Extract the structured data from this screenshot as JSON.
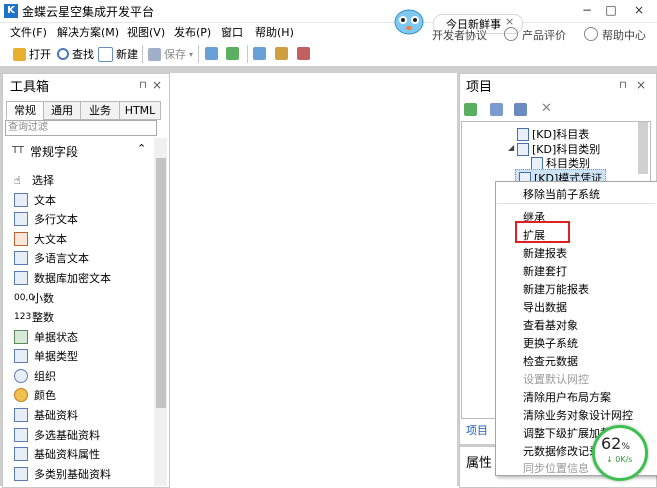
{
  "app": {
    "title": "金蝶云星空集成开发平台",
    "icon_glyph": "K"
  },
  "window_controls": [
    "−",
    "□",
    "×"
  ],
  "menu": [
    "文件(F)",
    "解决方案(M)",
    "视图(V)",
    "发布(P)",
    "窗口",
    "帮助(H)"
  ],
  "toolbar": {
    "open": "打开",
    "find": "查找",
    "new": "新建",
    "save": "保存"
  },
  "notification": {
    "text": "今日新鲜事",
    "close": "×"
  },
  "top_links": {
    "partial": "开发者协议",
    "rating": "产品评价",
    "help": "帮助中心"
  },
  "toolbox": {
    "title": "工具箱",
    "pin": "⊓",
    "close": "×",
    "tabs": [
      "常规",
      "通用",
      "业务",
      "HTML"
    ],
    "filter_placeholder": "查询过滤",
    "section_icon": "TT",
    "section": "常规字段",
    "items": [
      "选择",
      "文本",
      "多行文本",
      "大文本",
      "多语言文本",
      "数据库加密文本",
      "小数",
      "整数",
      "单据状态",
      "单据类型",
      "组织",
      "颜色",
      "基础资料",
      "多选基础资料",
      "基础资料属性",
      "多类别基础资料"
    ]
  },
  "project": {
    "title": "项目",
    "pin": "⊓",
    "close": "×",
    "tree": [
      {
        "label": "[KD]科目表",
        "level": 0
      },
      {
        "label": "[KD]科目类别",
        "level": 0,
        "expanded": true
      },
      {
        "label": "科目类别",
        "level": 1
      },
      {
        "label": "[KD]模式凭证",
        "level": 0
      }
    ],
    "tab_label": "项目"
  },
  "properties": {
    "title": "属性"
  },
  "context_menu": {
    "items": [
      {
        "label": "移除当前子系统",
        "enabled": true
      },
      {
        "label": "继承",
        "enabled": true
      },
      {
        "label": "扩展",
        "enabled": true,
        "highlighted": true
      },
      {
        "label": "新建报表",
        "enabled": true
      },
      {
        "label": "新建套打",
        "enabled": true
      },
      {
        "label": "新建万能报表",
        "enabled": true
      },
      {
        "label": "导出数据",
        "enabled": true
      },
      {
        "label": "查看基对象",
        "enabled": true
      },
      {
        "label": "更换子系统",
        "enabled": true
      },
      {
        "label": "检查元数据",
        "enabled": true
      },
      {
        "label": "设置默认网控",
        "enabled": false
      },
      {
        "label": "清除用户布局方案",
        "enabled": true
      },
      {
        "label": "清除业务对象设计网控",
        "enabled": true
      },
      {
        "label": "调整下级扩展加载顺序",
        "enabled": true
      },
      {
        "label": "元数据修改记录",
        "enabled": true
      },
      {
        "label": "同步位置信息",
        "enabled": false
      }
    ]
  },
  "gauge": {
    "value": "62",
    "unit": "%",
    "speed": "0K/s",
    "arrow": "↓"
  },
  "colors": {
    "accent": "#1e73c8",
    "highlight_border": "#e02020",
    "gauge_ring": "#3cc050"
  }
}
